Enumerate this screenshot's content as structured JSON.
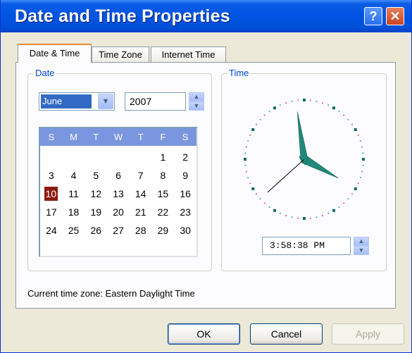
{
  "window": {
    "title": "Date and Time Properties",
    "help_label": "?",
    "close_label": "✕"
  },
  "tabs": [
    {
      "label": "Date & Time",
      "active": true
    },
    {
      "label": "Time Zone",
      "active": false
    },
    {
      "label": "Internet Time",
      "active": false
    }
  ],
  "date_group": {
    "label": "Date",
    "month": "June",
    "year": "2007",
    "day_headers": [
      "S",
      "M",
      "T",
      "W",
      "T",
      "F",
      "S"
    ],
    "days": [
      [
        "",
        "",
        "",
        "",
        "",
        "1",
        "2"
      ],
      [
        "3",
        "4",
        "5",
        "6",
        "7",
        "8",
        "9"
      ],
      [
        "10",
        "11",
        "12",
        "13",
        "14",
        "15",
        "16"
      ],
      [
        "17",
        "18",
        "19",
        "20",
        "21",
        "22",
        "23"
      ],
      [
        "24",
        "25",
        "26",
        "27",
        "28",
        "29",
        "30"
      ]
    ],
    "selected_day": "10"
  },
  "time_group": {
    "label": "Time",
    "time_value": "3:58:38 PM",
    "clock": {
      "hour": 15,
      "minute": 58,
      "second": 38
    }
  },
  "timezone": {
    "text": "Current time zone:  Eastern Daylight Time"
  },
  "buttons": {
    "ok": "OK",
    "cancel": "Cancel",
    "apply": "Apply"
  },
  "colors": {
    "titlebar": "#0054e3",
    "selected_day": "#8b1a12",
    "calendar_header": "#7a96df",
    "clock_hands": "#1f8a7c"
  }
}
